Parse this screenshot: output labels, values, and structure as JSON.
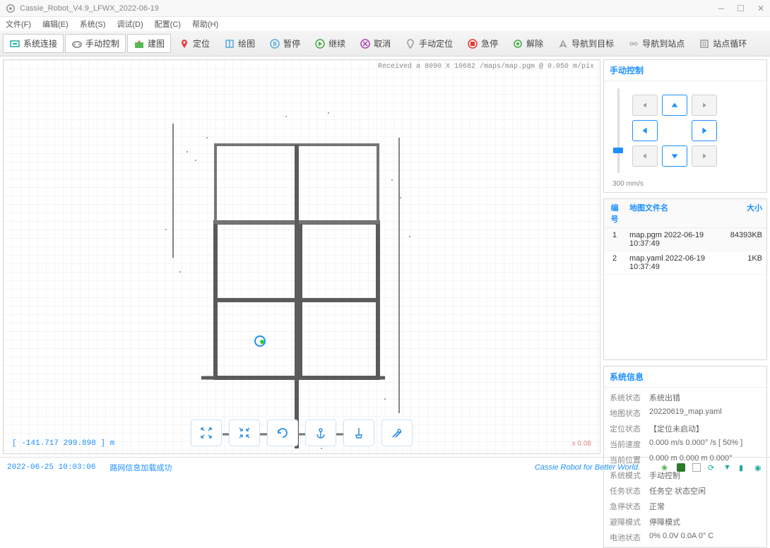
{
  "window": {
    "title": "Cassie_Robot_V4.9_LFWX_2022-06-19"
  },
  "menu": {
    "file": "文件(F)",
    "edit": "编辑(E)",
    "system": "系统(S)",
    "debug": "调试(D)",
    "config": "配置(C)",
    "help": "帮助(H)"
  },
  "toolbar": {
    "connect": "系统连接",
    "manual": "手动控制",
    "build_map": "建图",
    "locate": "定位",
    "draw": "绘图",
    "pause": "暂停",
    "resume": "继续",
    "cancel": "取消",
    "manual_locate": "手动定位",
    "estop": "急停",
    "unlock": "解除",
    "nav_target": "导航到目标",
    "nav_point": "导航到站点",
    "loop_points": "站点循环"
  },
  "map": {
    "status": "Received a 8090 X 10682 /maps/map.pgm @ 0.050 m/pix",
    "coord": "[ -141.717 299.898 ] m",
    "zoom": "x 0.08"
  },
  "right": {
    "manual_title": "手动控制",
    "speed": "300 mm/s",
    "table": {
      "h1": "编号",
      "h2": "地图文件名",
      "h3": "大小",
      "rows": [
        {
          "no": "1",
          "name": "map.pgm  2022-06-19 10:37:49",
          "size": "84393KB"
        },
        {
          "no": "2",
          "name": "map.yaml  2022-06-19 10:37:49",
          "size": "1KB"
        }
      ]
    },
    "sysinfo_title": "系统信息",
    "sysinfo": {
      "k1": "系统状态",
      "v1": "系统出错",
      "k2": "地图状态",
      "v2": "20220619_map.yaml",
      "k3": "定位状态",
      "v3": "【定位未启动】",
      "k4": "当前速度",
      "v4": "0.000 m/s  0.000° /s  [ 50% ]",
      "k5": "当前位置",
      "v5": "0.000 m  0.000 m  0.000°",
      "k6": "系统模式",
      "v6": "手动控制",
      "k7": "任务状态",
      "v7": "任务空        状态空闲",
      "k8": "急停状态",
      "v8": "正常",
      "k9": "避障模式",
      "v9": "停障模式",
      "k10": "电池状态",
      "v10": "0%   0.0V   0.0A   0° C"
    }
  },
  "statusbar": {
    "timestamp": "2022-06-25 10:03:06",
    "message": "路网信息加载成功",
    "slogan": "Cassie Robot for Better World."
  }
}
